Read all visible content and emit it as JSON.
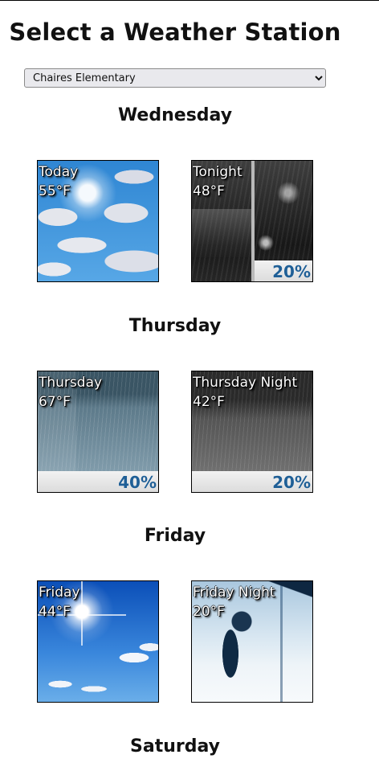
{
  "page_title": "Select a Weather Station",
  "station_select": {
    "selected": "Chaires Elementary",
    "options": [
      "Chaires Elementary"
    ]
  },
  "days": [
    {
      "name": "Wednesday",
      "periods": [
        {
          "label": "Today",
          "temp": "55°F",
          "image": "partly-cloudy-sun",
          "pop": ""
        },
        {
          "label": "Tonight",
          "temp": "48°F",
          "image": "night-rain",
          "pop": "20%"
        }
      ]
    },
    {
      "name": "Thursday",
      "periods": [
        {
          "label": "Thursday",
          "temp": "67°F",
          "image": "rain-showers",
          "pop": "40%"
        },
        {
          "label": "Thursday Night",
          "temp": "42°F",
          "image": "night-rain-showers",
          "pop": "20%"
        }
      ]
    },
    {
      "name": "Friday",
      "periods": [
        {
          "label": "Friday",
          "temp": "44°F",
          "image": "sunny",
          "pop": ""
        },
        {
          "label": "Friday Night",
          "temp": "20°F",
          "image": "windy-cold",
          "pop": ""
        }
      ]
    },
    {
      "name": "Saturday",
      "periods": []
    }
  ]
}
